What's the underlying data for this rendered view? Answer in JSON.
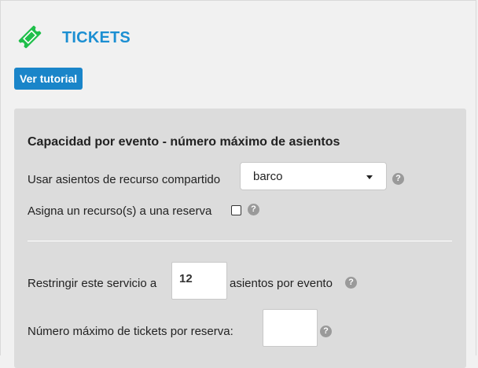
{
  "header": {
    "title": "TICKETS",
    "icon": "ticket-icon",
    "tutorial_label": "Ver tutorial"
  },
  "panel": {
    "section_title": "Capacidad por evento - número máximo de asientos",
    "shared_resource": {
      "label": "Usar asientos de recurso compartido",
      "selected": "barco"
    },
    "assign_resource": {
      "label": "Asigna un recurso(s) a una reserva",
      "checked": false
    },
    "restrict": {
      "label_before": "Restringir este servicio a",
      "value": "12",
      "label_after": "asientos por evento"
    },
    "max_tickets": {
      "label": "Número máximo de tickets por reserva:",
      "value": ""
    },
    "help_glyph": "?"
  },
  "colors": {
    "accent": "#1c8fd2",
    "button": "#1a85c9",
    "icon_green": "#1fbf4a",
    "panel": "#dcdcdc"
  }
}
